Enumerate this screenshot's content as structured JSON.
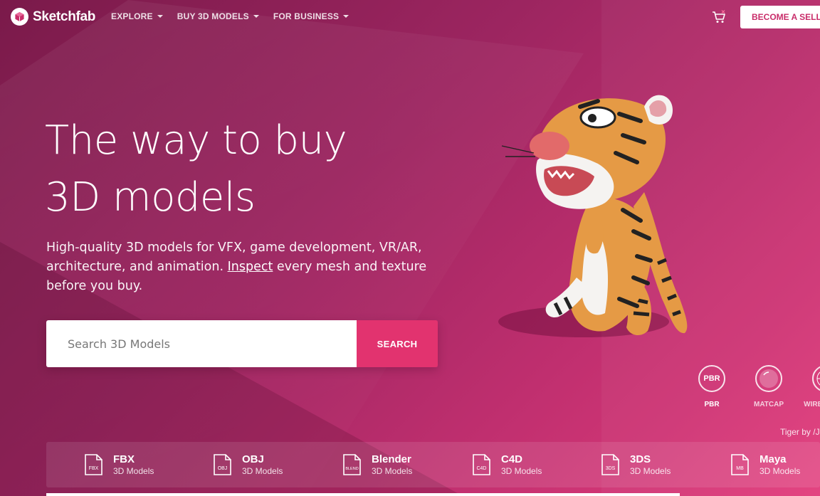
{
  "header": {
    "brand": "Sketchfab",
    "nav": [
      {
        "label": "EXPLORE"
      },
      {
        "label": "BUY 3D MODELS"
      },
      {
        "label": "FOR BUSINESS"
      }
    ],
    "seller_button": "BECOME A SELLER"
  },
  "hero": {
    "headline_line1": "The way to buy",
    "headline_line2": "3D models",
    "sub_before": "High-quality 3D models for VFX, game development, VR/AR, architecture, and animation. ",
    "sub_link": "Inspect",
    "sub_after": " every mesh and texture before you buy.",
    "search_placeholder": "Search 3D Models",
    "search_button": "SEARCH"
  },
  "render_modes": [
    {
      "label": "PBR",
      "icon_text": "PBR"
    },
    {
      "label": "MATCAP",
      "icon_text": ""
    },
    {
      "label": "WIREFRAME",
      "icon_text": ""
    }
  ],
  "credit": "Tiger by /J",
  "formats": [
    {
      "name": "FBX",
      "sub": "3D Models",
      "icon_text": "FBX"
    },
    {
      "name": "OBJ",
      "sub": "3D Models",
      "icon_text": "OBJ"
    },
    {
      "name": "Blender",
      "sub": "3D Models",
      "icon_text": "BLEND"
    },
    {
      "name": "C4D",
      "sub": "3D Models",
      "icon_text": "C4D"
    },
    {
      "name": "3DS",
      "sub": "3D Models",
      "icon_text": "3DS"
    },
    {
      "name": "Maya",
      "sub": "3D Models",
      "icon_text": "MB"
    }
  ],
  "colors": {
    "accent": "#e2336f",
    "background_dark": "#7a1a4a",
    "background_light": "#e23d7c"
  }
}
